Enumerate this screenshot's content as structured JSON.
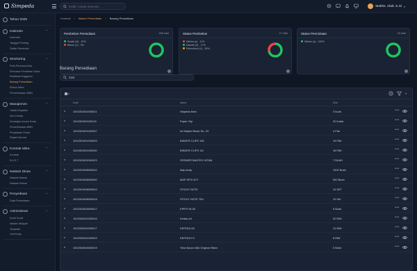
{
  "header": {
    "app_name": "Simpeda",
    "search_placeholder": "Ketik / untuk mencari...",
    "user_name": "Mokhs. Abdi. S.Si"
  },
  "sidebar": {
    "year": "Tahun 2025",
    "groups": [
      {
        "label": "Kalender",
        "items": [
          "Kalender",
          "Tanggal Penting",
          "Daftar Reminder"
        ]
      },
      {
        "label": "Monitoring",
        "items": [
          "Peta Rencana Aksi",
          "Rencana Penarikan Dana",
          "Realisasi Anggaran",
          "Barang Persediaan",
          "Rekon Mitra",
          "Pemeliharaan BMN"
        ]
      },
      {
        "label": "Manajemen",
        "items": [
          "Hasta Kegiatan",
          "Info Kinerja",
          "Kerangka Acuan Kerja",
          "Pemeliharaan BMN",
          "Perjalanan Dinas",
          "Rapat Internal"
        ]
      },
      {
        "label": "Kontrak Mitra",
        "items": [
          "Kontrak",
          "B A S T"
        ]
      },
      {
        "label": "Naskah Dinas",
        "items": [
          "Naskah Masuk",
          "Naskah Keluar"
        ]
      },
      {
        "label": "Penyediaan",
        "items": [
          "Data Permintaan"
        ]
      },
      {
        "label": "Administrasi",
        "items": [
          "Kode Surat",
          "Master Wilayah",
          "Template",
          "Unit Kerja"
        ]
      }
    ],
    "active_item": "Barang Persediaan"
  },
  "breadcrumb": {
    "home": "Kembali",
    "section": "Master Persediaan",
    "current": "Barang Persediaan"
  },
  "cards": [
    {
      "title": "Pembelian Persediaan",
      "count": "188 total",
      "legend": [
        "Sudah (D) - 87%",
        "Belum (1) - 0%"
      ],
      "color": "#22c55e",
      "segments": [
        {
          "value": 1,
          "color": "#22c55e"
        }
      ]
    },
    {
      "title": "Status Pembelian",
      "count": "27 total",
      "legend": [
        "Dikirim (n) - 11%",
        "Diambil (3) - 17%",
        "Dicheckout (1) - 39%"
      ],
      "legend_colors": [
        "#ef4444",
        "#22c55e",
        "#f59e0b"
      ],
      "segments": [
        {
          "value": 0.72,
          "color": "#22c55e"
        },
        {
          "value": 0.28,
          "color": "#ef4444"
        }
      ]
    },
    {
      "title": "Status Permintaan",
      "count": "18 total",
      "legend": [
        "Dikirim (4) - 100%"
      ],
      "legend_colors": [
        "#22c55e"
      ],
      "segments": [
        {
          "value": 1,
          "color": "#22c55e"
        }
      ]
    }
  ],
  "section_title": "Barang Persediaan",
  "table_search_value": "Cari",
  "table": {
    "columns": [
      "Kode",
      "Nama",
      "Stok"
    ],
    "rows": [
      [
        "1010301001000021",
        "Stapless Besi",
        "3 buah"
      ],
      [
        "1010301001000111",
        "Paper Clip",
        "20 Kotak"
      ],
      [
        "1010301001000257",
        "Isi Stapler Besar No. 23",
        "4 Pak"
      ],
      [
        "1010301001000033",
        "BINDER CLIPS 105",
        "15 PAK"
      ],
      [
        "1010301001000030",
        "BINDER CLIPS 111",
        "16 PAK"
      ],
      [
        "1010301001000423",
        "ORDNER BANTEX HITAM",
        "7 BUAH"
      ],
      [
        "1010301008000010",
        "Map Arsip",
        "1000 Buah"
      ],
      [
        "1010301008000040",
        "MAP SPS HIJT",
        "500 Buah"
      ],
      [
        "1010301008000043",
        "STICKY NOTE",
        "10 SET"
      ],
      [
        "1010301008000018",
        "STICKY NOTE TBJ",
        "10 Set"
      ],
      [
        "1010301003000017",
        "KIPPO M-35",
        "5 Buah"
      ],
      [
        "1010302001000016",
        "Kertas A4",
        "20 RIM"
      ],
      [
        "1010302001000017",
        "KERTAS A3",
        "12 RIM"
      ],
      [
        "1010302001000029",
        "KERTAS F4",
        "8 RIM"
      ],
      [
        "1010304004000019",
        "Tinta Epson 664 Original Hitam",
        "0 Botol"
      ]
    ]
  }
}
